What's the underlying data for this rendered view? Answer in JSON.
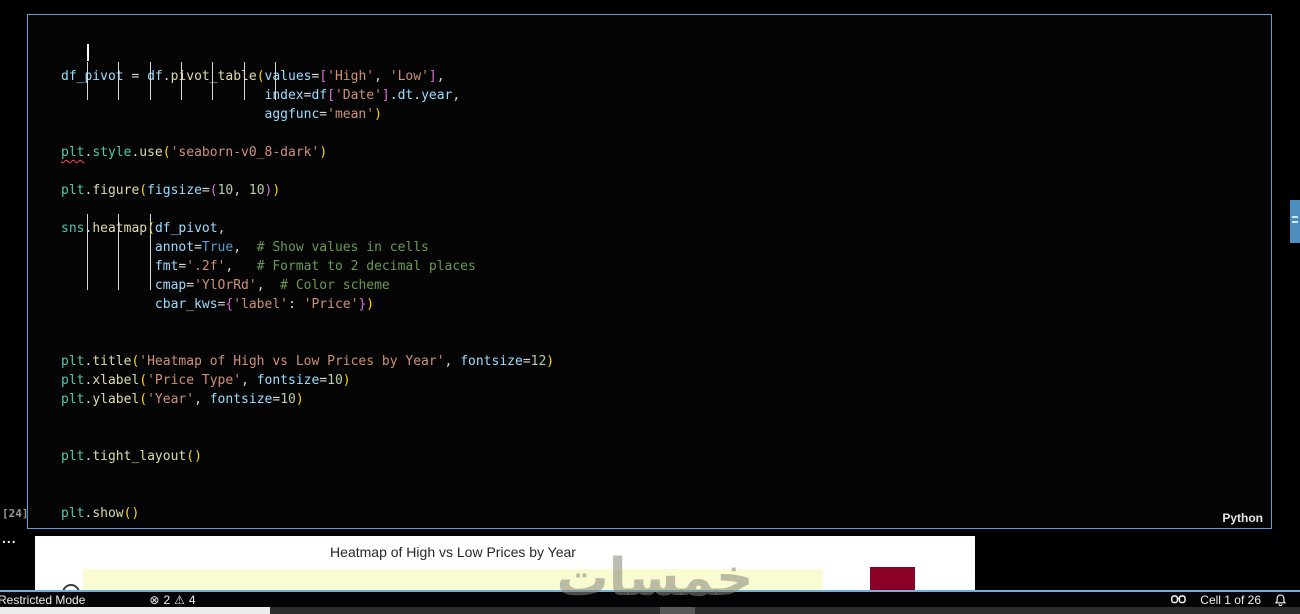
{
  "editor": {
    "language_label": "Python",
    "execution_count": "[24]",
    "overflow_dots": "...",
    "code_lines": [
      {
        "tokens": [
          [
            "v",
            "df_pivot"
          ],
          [
            "p",
            " = "
          ],
          [
            "v",
            "df"
          ],
          [
            "p",
            "."
          ],
          [
            "f",
            "pivot_table"
          ],
          [
            "a",
            "("
          ],
          [
            "v",
            "values"
          ],
          [
            "p",
            "="
          ],
          [
            "b",
            "["
          ],
          [
            "s",
            "'High'"
          ],
          [
            "p",
            ", "
          ],
          [
            "s",
            "'Low'"
          ],
          [
            "b",
            "]"
          ],
          [
            "p",
            ","
          ]
        ]
      },
      {
        "tokens": [
          [
            "p",
            "                          "
          ],
          [
            "v",
            "index"
          ],
          [
            "p",
            "="
          ],
          [
            "v",
            "df"
          ],
          [
            "b",
            "["
          ],
          [
            "s",
            "'Date'"
          ],
          [
            "b",
            "]"
          ],
          [
            "p",
            "."
          ],
          [
            "v",
            "dt"
          ],
          [
            "p",
            "."
          ],
          [
            "v",
            "year"
          ],
          [
            "p",
            ","
          ]
        ]
      },
      {
        "tokens": [
          [
            "p",
            "                          "
          ],
          [
            "v",
            "aggfunc"
          ],
          [
            "p",
            "="
          ],
          [
            "s",
            "'mean'"
          ],
          [
            "a",
            ")"
          ]
        ]
      },
      {
        "tokens": []
      },
      {
        "tokens": [
          [
            "q",
            "plt"
          ],
          [
            "p",
            "."
          ],
          [
            "m",
            "style"
          ],
          [
            "p",
            "."
          ],
          [
            "f",
            "use"
          ],
          [
            "a",
            "("
          ],
          [
            "s",
            "'seaborn-v0_8-dark'"
          ],
          [
            "a",
            ")"
          ]
        ]
      },
      {
        "tokens": []
      },
      {
        "tokens": [
          [
            "m",
            "plt"
          ],
          [
            "p",
            "."
          ],
          [
            "f",
            "figure"
          ],
          [
            "a",
            "("
          ],
          [
            "v",
            "figsize"
          ],
          [
            "p",
            "="
          ],
          [
            "b",
            "("
          ],
          [
            "n",
            "10"
          ],
          [
            "p",
            ", "
          ],
          [
            "n",
            "10"
          ],
          [
            "b",
            ")"
          ],
          [
            "a",
            ")"
          ]
        ]
      },
      {
        "tokens": []
      },
      {
        "tokens": [
          [
            "m",
            "sns"
          ],
          [
            "p",
            "."
          ],
          [
            "f",
            "heatmap"
          ],
          [
            "a",
            "("
          ],
          [
            "v",
            "df_pivot"
          ],
          [
            "p",
            ","
          ]
        ]
      },
      {
        "tokens": [
          [
            "p",
            "            "
          ],
          [
            "v",
            "annot"
          ],
          [
            "p",
            "="
          ],
          [
            "k",
            "True"
          ],
          [
            "p",
            ",  "
          ],
          [
            "c",
            "# Show values in cells"
          ]
        ]
      },
      {
        "tokens": [
          [
            "p",
            "            "
          ],
          [
            "v",
            "fmt"
          ],
          [
            "p",
            "="
          ],
          [
            "s",
            "'.2f'"
          ],
          [
            "p",
            ",   "
          ],
          [
            "c",
            "# Format to 2 decimal places"
          ]
        ]
      },
      {
        "tokens": [
          [
            "p",
            "            "
          ],
          [
            "v",
            "cmap"
          ],
          [
            "p",
            "="
          ],
          [
            "s",
            "'YlOrRd'"
          ],
          [
            "p",
            ",  "
          ],
          [
            "c",
            "# Color scheme"
          ]
        ]
      },
      {
        "tokens": [
          [
            "p",
            "            "
          ],
          [
            "v",
            "cbar_kws"
          ],
          [
            "p",
            "="
          ],
          [
            "b",
            "{"
          ],
          [
            "s",
            "'label'"
          ],
          [
            "p",
            ": "
          ],
          [
            "s",
            "'Price'"
          ],
          [
            "b",
            "}"
          ],
          [
            "a",
            ")"
          ]
        ]
      },
      {
        "tokens": []
      },
      {
        "tokens": []
      },
      {
        "tokens": [
          [
            "m",
            "plt"
          ],
          [
            "p",
            "."
          ],
          [
            "f",
            "title"
          ],
          [
            "a",
            "("
          ],
          [
            "s",
            "'Heatmap of High vs Low Prices by Year'"
          ],
          [
            "p",
            ", "
          ],
          [
            "v",
            "fontsize"
          ],
          [
            "p",
            "="
          ],
          [
            "n",
            "12"
          ],
          [
            "a",
            ")"
          ]
        ]
      },
      {
        "tokens": [
          [
            "m",
            "plt"
          ],
          [
            "p",
            "."
          ],
          [
            "f",
            "xlabel"
          ],
          [
            "a",
            "("
          ],
          [
            "s",
            "'Price Type'"
          ],
          [
            "p",
            ", "
          ],
          [
            "v",
            "fontsize"
          ],
          [
            "p",
            "="
          ],
          [
            "n",
            "10"
          ],
          [
            "a",
            ")"
          ]
        ]
      },
      {
        "tokens": [
          [
            "m",
            "plt"
          ],
          [
            "p",
            "."
          ],
          [
            "f",
            "ylabel"
          ],
          [
            "a",
            "("
          ],
          [
            "s",
            "'Year'"
          ],
          [
            "p",
            ", "
          ],
          [
            "v",
            "fontsize"
          ],
          [
            "p",
            "="
          ],
          [
            "n",
            "10"
          ],
          [
            "a",
            ")"
          ]
        ]
      },
      {
        "tokens": []
      },
      {
        "tokens": []
      },
      {
        "tokens": [
          [
            "m",
            "plt"
          ],
          [
            "p",
            "."
          ],
          [
            "f",
            "tight_layout"
          ],
          [
            "a",
            "("
          ],
          [
            "a",
            ")"
          ]
        ]
      },
      {
        "tokens": []
      },
      {
        "tokens": []
      },
      {
        "tokens": [
          [
            "m",
            "plt"
          ],
          [
            "p",
            "."
          ],
          [
            "f",
            "show"
          ],
          [
            "a",
            "("
          ],
          [
            "a",
            ")"
          ]
        ]
      }
    ]
  },
  "output": {
    "figure_title": "Heatmap of High vs Low Prices by Year",
    "heatmap_top_row_color": "#FBFBD2",
    "colorbar_top_color": "#8B0026"
  },
  "watermark": {
    "text": "خمسات"
  },
  "status_bar": {
    "restricted_mode_label": "Restricted Mode",
    "error_icon": "⊗",
    "error_count": "2",
    "warning_icon": "⚠",
    "warning_count": "4",
    "cell_indicator": "Cell 1 of 26"
  },
  "colors": {
    "cell_border": "#5C9FD4",
    "accent_line": "#6CB2E0",
    "editor_background": "#050505"
  }
}
